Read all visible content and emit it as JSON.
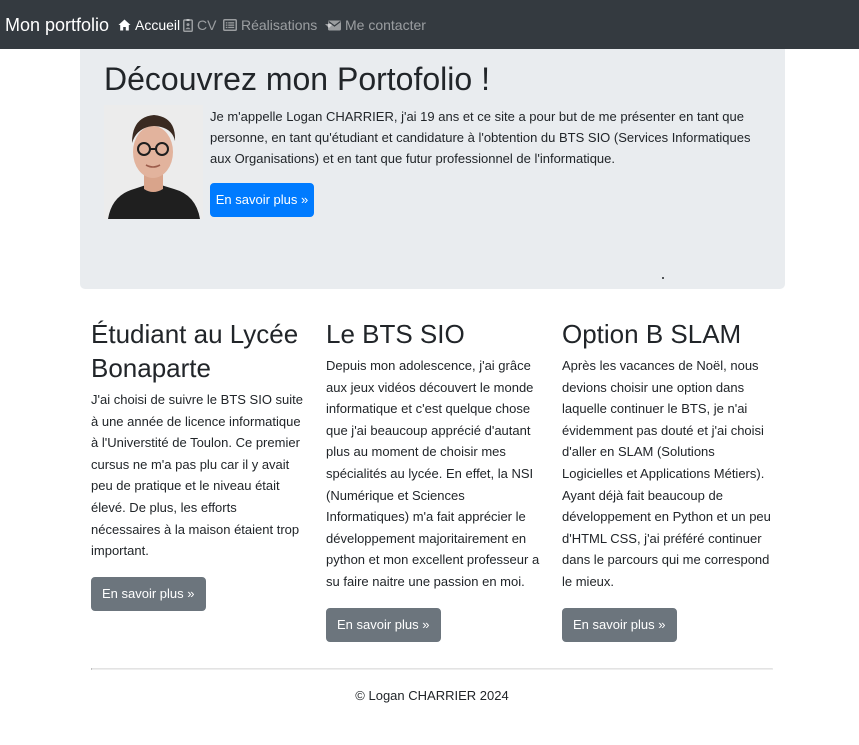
{
  "navbar": {
    "brand": "Mon portfolio",
    "items": [
      {
        "label": "Accueil",
        "icon": "home-icon",
        "active": true
      },
      {
        "label": "CV",
        "icon": "id-badge-icon",
        "active": false
      },
      {
        "label": "Réalisations",
        "icon": "list-icon",
        "active": false,
        "dropdown": true
      },
      {
        "label": "Me contacter",
        "icon": "envelope-icon",
        "active": false
      }
    ]
  },
  "jumbotron": {
    "title": "Découvrez mon Portofolio !",
    "text": "Je m'appelle Logan CHARRIER, j'ai 19 ans et ce site a pour but de me présenter en tant que personne, en tant qu'étudiant et candidature à l'obtention du BTS SIO (Services Informatiques aux Organisations) et en tant que futur professionnel de l'informatique.",
    "button": "En savoir plus »",
    "stray_mark": "."
  },
  "columns": [
    {
      "title": "Étudiant au Lycée Bonaparte",
      "text": "J'ai choisi de suivre le BTS SIO suite à une année de licence informatique à l'Universtité de Toulon. Ce premier cursus ne m'a pas plu car il y avait peu de pratique et le niveau était élevé. De plus, les efforts nécessaires à la maison étaient trop important.",
      "button": "En savoir plus »"
    },
    {
      "title": "Le BTS SIO",
      "text": "Depuis mon adolescence, j'ai grâce aux jeux vidéos découvert le monde informatique et c'est quelque chose que j'ai beaucoup apprécié d'autant plus au moment de choisir mes spécialités au lycée. En effet, la NSI (Numérique et Sciences Informatiques) m'a fait apprécier le développement majoritairement en python et mon excellent professeur a su faire naitre une passion en moi.",
      "button": "En savoir plus »"
    },
    {
      "title": "Option B SLAM",
      "text": "Après les vacances de Noël, nous devions choisir une option dans laquelle continuer le BTS, je n'ai évidemment pas douté et j'ai choisi d'aller en SLAM (Solutions Logicielles et Applications Métiers). Ayant déjà fait beaucoup de développement en Python et un peu d'HTML CSS, j'ai préféré continuer dans le parcours qui me correspond le mieux.",
      "button": "En savoir plus »"
    }
  ],
  "footer": {
    "text": "© Logan CHARRIER 2024"
  },
  "colors": {
    "navbar_bg": "#343a40",
    "jumbotron_bg": "#e9ecef",
    "primary": "#007bff",
    "secondary": "#6c757d",
    "text": "#212529"
  }
}
